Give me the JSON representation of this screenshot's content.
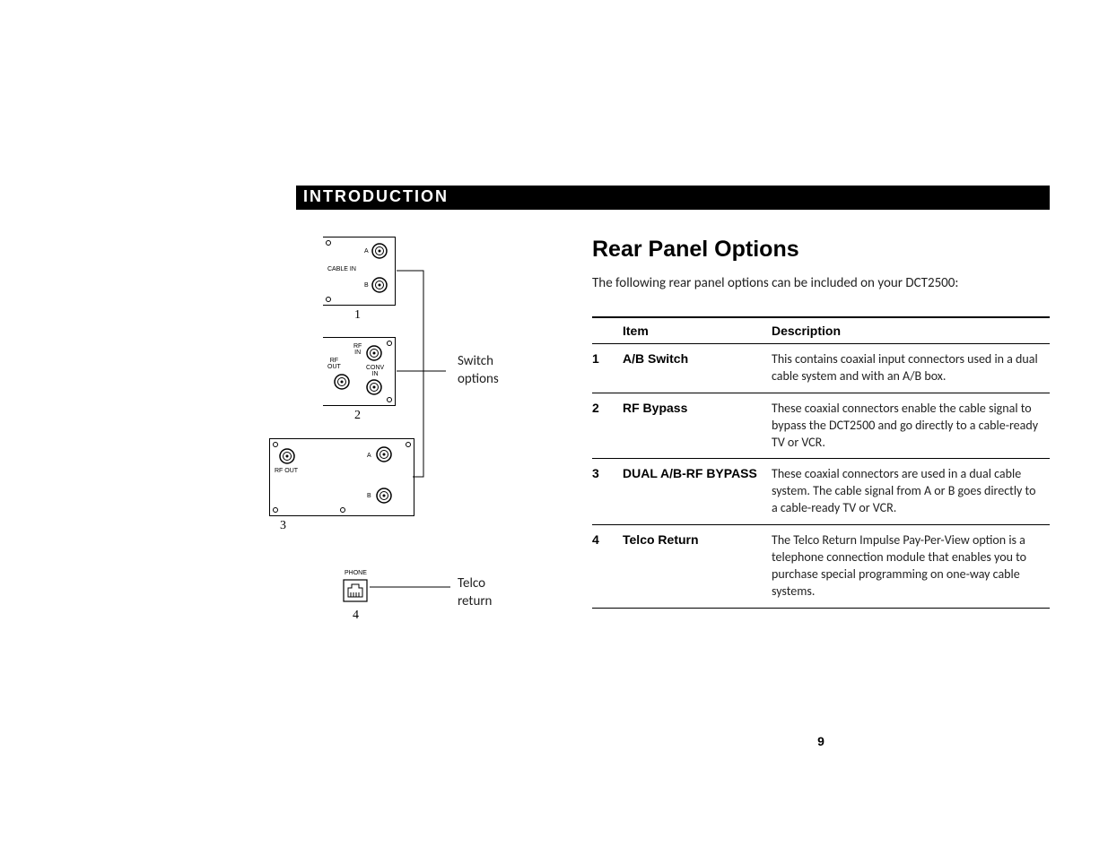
{
  "section_header": "INTRODUCTION",
  "title": "Rear Panel Options",
  "intro": "The following rear panel options can be included on your DCT2500:",
  "table": {
    "headers": {
      "item": "Item",
      "description": "Description"
    },
    "rows": [
      {
        "num": "1",
        "item": "A/B Switch",
        "desc": "This contains coaxial input connectors used in a dual cable system and with an A/B box."
      },
      {
        "num": "2",
        "item": "RF Bypass",
        "desc": "These coaxial connectors enable the cable signal to bypass the DCT2500 and go directly to a cable-ready TV or VCR."
      },
      {
        "num": "3",
        "item": "DUAL A/B-RF BYPASS",
        "desc": "These coaxial connectors are used in a dual cable system. The cable signal from A or B goes directly to a cable-ready TV or VCR."
      },
      {
        "num": "4",
        "item": "Telco Return",
        "desc": "The Telco Return Impulse Pay-Per-View option is a telephone connection module that enables you to purchase special programming on one-way cable systems."
      }
    ]
  },
  "diagram": {
    "labels": {
      "cable_in": "CABLE IN",
      "a": "A",
      "b": "B",
      "rf_out": "RF OUT",
      "rf_in": "RF IN",
      "conv_in": "CONV IN",
      "phone": "PHONE",
      "switch_options": "Switch options",
      "telco_return": "Telco return",
      "n1": "1",
      "n2": "2",
      "n3": "3",
      "n4": "4"
    }
  },
  "page_number": "9"
}
